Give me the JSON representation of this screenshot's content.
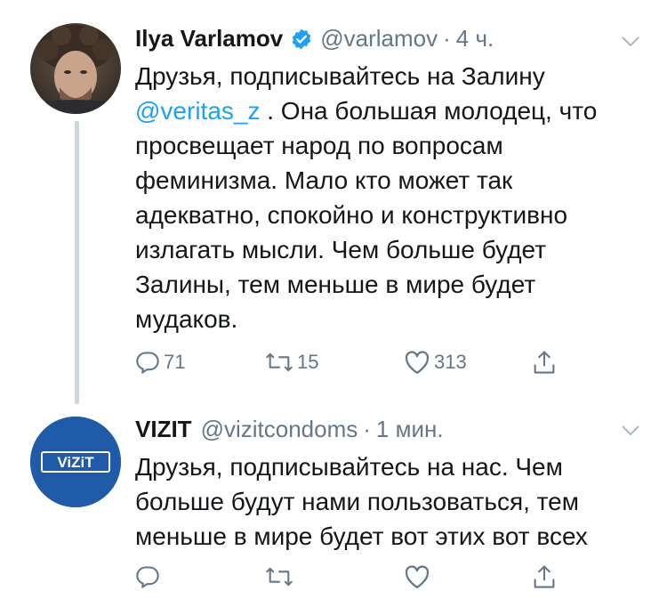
{
  "tweets": [
    {
      "name": "Ilya Varlamov",
      "verified": true,
      "handle": "@varlamov",
      "separator": "·",
      "time": "4 ч.",
      "text_before": "Друзья, подписывайтесь на Залину ",
      "mention": "@veritas_z",
      "text_after": " . Она большая молодец, что просвещает народ по вопросам феминизма. Мало кто может так адекватно, спокойно и конструктивно излагать мысли. Чем больше будет Залины, тем меньше в мире будет мудаков.",
      "reply_count": "71",
      "retweet_count": "15",
      "like_count": "313"
    },
    {
      "name": "VIZIT",
      "avatar_text": "ViZiT",
      "handle": "@vizitcondoms",
      "separator": "·",
      "time": "1 мин.",
      "text": "Друзья, подписывайтесь на нас. Чем больше будут нами пользоваться, тем меньше в мире будет вот этих вот всех",
      "reply_count": "",
      "retweet_count": "",
      "like_count": ""
    }
  ],
  "colors": {
    "accent": "#1da1f2",
    "secondary_text": "#657786",
    "thread_line": "#ccd6dd",
    "vizit_blue": "#1f5ba9"
  },
  "icons": [
    "chevron-down-icon",
    "verified-badge-icon",
    "reply-icon",
    "retweet-icon",
    "like-icon",
    "share-icon"
  ]
}
